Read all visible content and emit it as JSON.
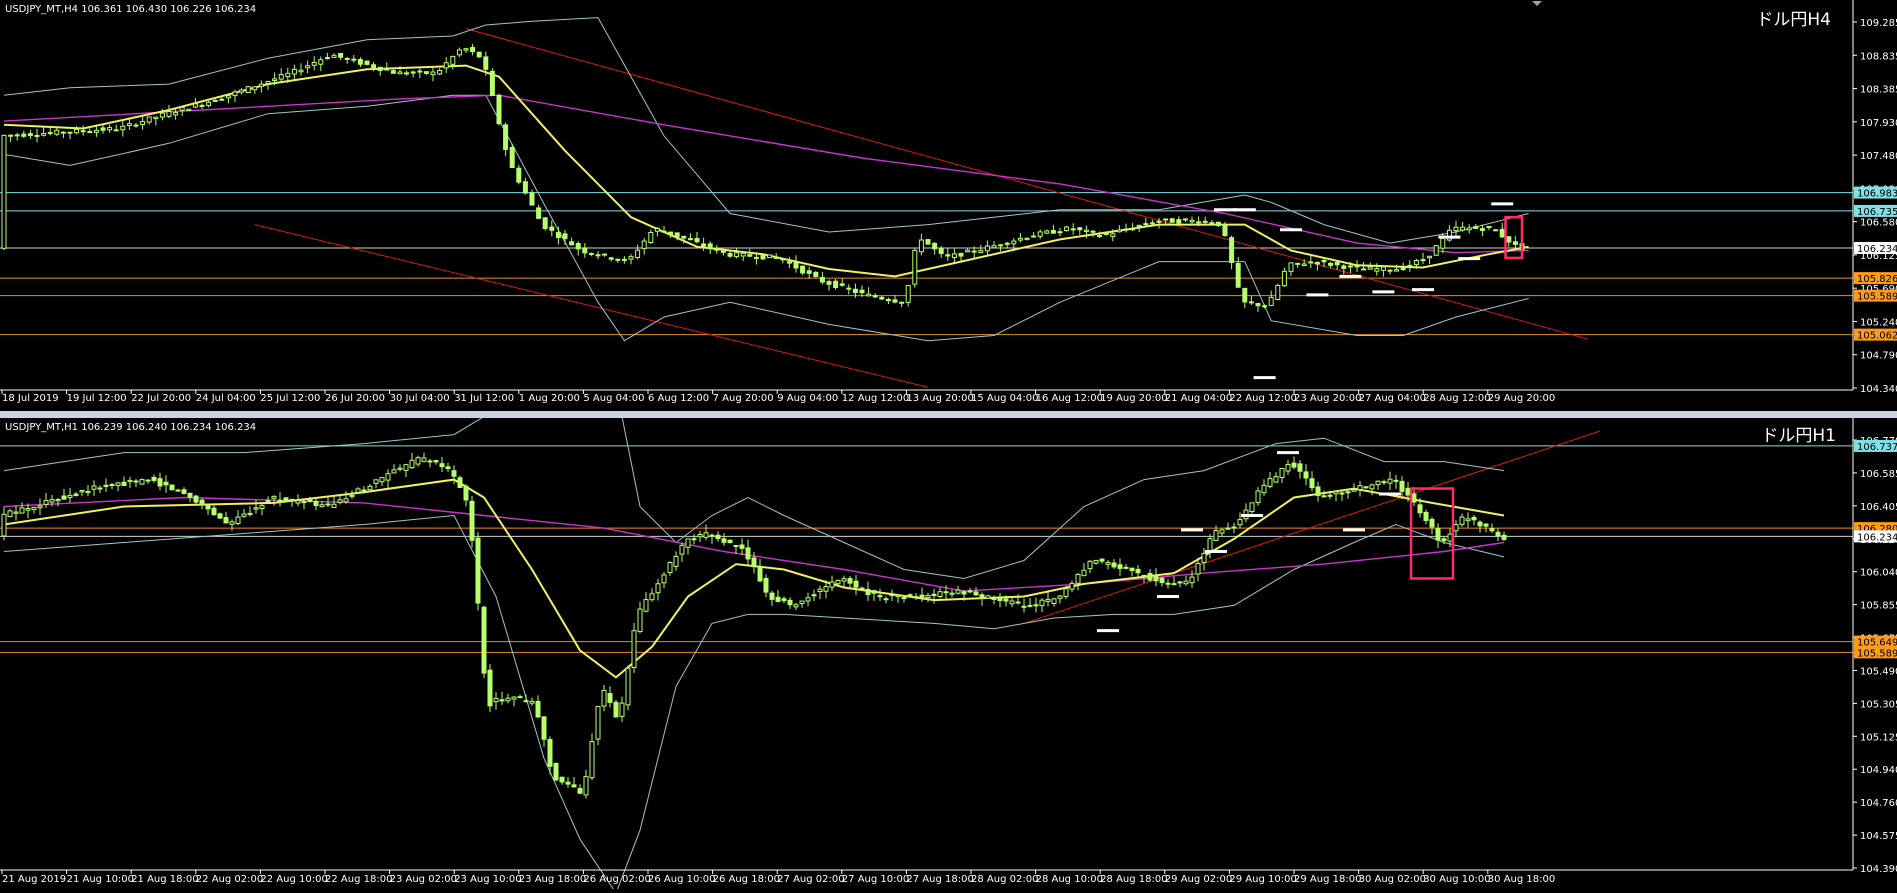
{
  "colors": {
    "background": "#000000",
    "axis": "#ffffff",
    "candle": "#b7ff6b",
    "ma_short": "#f0f060",
    "ma_long": "#cc33cc",
    "band": "#9ec7c7",
    "trend": "#e01818",
    "level_cyan": "#7fe0e6",
    "level_orange": "#f08a2a",
    "level_white": "#d0d0d0",
    "highlight": "#ff2a6d",
    "badge_orange": "#ff9a1a",
    "badge_cyan": "#7fe0e6",
    "badge_white": "#ffffff"
  },
  "chart_data": [
    {
      "type": "candlestick",
      "info": "USDJPY_MT,H4  106.361 106.430 106.226 106.234",
      "title": "ドル円H4",
      "ylim": [
        104.34,
        109.29
      ],
      "y_ticks": [
        "109.285",
        "108.835",
        "108.385",
        "107.930",
        "107.480",
        "107.030",
        "106.580",
        "106.125",
        "105.690",
        "105.240",
        "104.790",
        "104.340"
      ],
      "x_ticks": [
        "18 Jul 2019",
        "19 Jul 12:00",
        "22 Jul 20:00",
        "24 Jul 04:00",
        "25 Jul 12:00",
        "26 Jul 20:00",
        "30 Jul 04:00",
        "31 Jul 12:00",
        "1 Aug 20:00",
        "5 Aug 04:00",
        "6 Aug 12:00",
        "7 Aug 20:00",
        "9 Aug 04:00",
        "12 Aug 12:00",
        "13 Aug 20:00",
        "15 Aug 04:00",
        "16 Aug 12:00",
        "19 Aug 20:00",
        "21 Aug 04:00",
        "22 Aug 12:00",
        "23 Aug 20:00",
        "27 Aug 04:00",
        "28 Aug 12:00",
        "29 Aug 20:00"
      ],
      "anchors": [
        [
          0,
          107.75
        ],
        [
          18,
          107.85
        ],
        [
          25,
          108.05
        ],
        [
          33,
          108.25
        ],
        [
          44,
          108.6
        ],
        [
          50,
          108.85
        ],
        [
          60,
          108.6
        ],
        [
          66,
          108.6
        ],
        [
          70,
          108.95
        ],
        [
          73,
          108.8
        ],
        [
          77,
          107.4
        ],
        [
          82,
          106.55
        ],
        [
          88,
          106.2
        ],
        [
          95,
          106.05
        ],
        [
          99,
          106.5
        ],
        [
          104,
          106.35
        ],
        [
          110,
          106.15
        ],
        [
          118,
          106.1
        ],
        [
          124,
          105.8
        ],
        [
          131,
          105.6
        ],
        [
          137,
          105.5
        ],
        [
          139,
          106.4
        ],
        [
          143,
          106.1
        ],
        [
          150,
          106.25
        ],
        [
          156,
          106.4
        ],
        [
          162,
          106.5
        ],
        [
          167,
          106.4
        ],
        [
          175,
          106.6
        ],
        [
          182,
          106.6
        ],
        [
          185,
          106.55
        ],
        [
          188,
          105.5
        ],
        [
          192,
          105.45
        ],
        [
          195,
          106.0
        ],
        [
          199,
          106.05
        ],
        [
          206,
          105.95
        ],
        [
          212,
          105.95
        ],
        [
          216,
          106.1
        ],
        [
          220,
          106.5
        ],
        [
          226,
          106.5
        ],
        [
          230,
          106.23
        ]
      ],
      "ma_short": [
        [
          0,
          107.9
        ],
        [
          12,
          107.85
        ],
        [
          25,
          108.1
        ],
        [
          40,
          108.45
        ],
        [
          55,
          108.65
        ],
        [
          70,
          108.7
        ],
        [
          75,
          108.55
        ],
        [
          85,
          107.55
        ],
        [
          95,
          106.65
        ],
        [
          105,
          106.25
        ],
        [
          115,
          106.15
        ],
        [
          125,
          105.95
        ],
        [
          135,
          105.85
        ],
        [
          145,
          106.05
        ],
        [
          160,
          106.35
        ],
        [
          175,
          106.55
        ],
        [
          188,
          106.55
        ],
        [
          195,
          106.2
        ],
        [
          205,
          106.0
        ],
        [
          215,
          105.97
        ],
        [
          225,
          106.15
        ],
        [
          231,
          106.25
        ]
      ],
      "ma_long": [
        [
          0,
          107.95
        ],
        [
          30,
          108.1
        ],
        [
          60,
          108.25
        ],
        [
          75,
          108.3
        ],
        [
          100,
          107.9
        ],
        [
          130,
          107.45
        ],
        [
          160,
          107.1
        ],
        [
          185,
          106.7
        ],
        [
          205,
          106.3
        ],
        [
          220,
          106.17
        ],
        [
          231,
          106.2
        ]
      ],
      "band_upper": [
        [
          0,
          108.3
        ],
        [
          10,
          108.4
        ],
        [
          25,
          108.45
        ],
        [
          40,
          108.8
        ],
        [
          55,
          109.05
        ],
        [
          68,
          109.1
        ],
        [
          73,
          109.25
        ],
        [
          80,
          109.3
        ],
        [
          90,
          109.35
        ],
        [
          100,
          107.75
        ],
        [
          110,
          106.7
        ],
        [
          125,
          106.45
        ],
        [
          140,
          106.55
        ],
        [
          160,
          106.75
        ],
        [
          175,
          106.75
        ],
        [
          188,
          106.95
        ],
        [
          192,
          106.85
        ],
        [
          200,
          106.55
        ],
        [
          210,
          106.3
        ],
        [
          220,
          106.45
        ],
        [
          231,
          106.7
        ]
      ],
      "band_lower": [
        [
          0,
          107.5
        ],
        [
          10,
          107.35
        ],
        [
          25,
          107.65
        ],
        [
          40,
          108.05
        ],
        [
          55,
          108.15
        ],
        [
          68,
          108.3
        ],
        [
          73,
          108.3
        ],
        [
          82,
          106.8
        ],
        [
          90,
          105.5
        ],
        [
          94,
          104.98
        ],
        [
          100,
          105.3
        ],
        [
          110,
          105.5
        ],
        [
          125,
          105.2
        ],
        [
          140,
          104.98
        ],
        [
          150,
          105.05
        ],
        [
          160,
          105.5
        ],
        [
          175,
          106.05
        ],
        [
          188,
          106.05
        ],
        [
          192,
          105.25
        ],
        [
          205,
          105.05
        ],
        [
          212,
          105.05
        ],
        [
          220,
          105.3
        ],
        [
          231,
          105.55
        ]
      ],
      "trend_lines": [
        {
          "x1": 70,
          "y1": 109.2,
          "x2": 240,
          "y2": 105.0
        },
        {
          "x1": 38,
          "y1": 106.55,
          "x2": 140,
          "y2": 104.35
        }
      ],
      "h_lines": [
        {
          "value": 106.983,
          "label": "106.983",
          "kind": "cyan"
        },
        {
          "value": 106.735,
          "label": "106.735",
          "kind": "cyan"
        },
        {
          "value": 106.234,
          "label": "106.234",
          "kind": "white"
        },
        {
          "value": 105.826,
          "label": "105.826",
          "kind": "orange"
        },
        {
          "value": 105.589,
          "label": "105.589",
          "kind": "orange"
        },
        {
          "value": 105.062,
          "label": "105.062",
          "kind": "orange"
        }
      ],
      "markers": [
        [
          185,
          106.75
        ],
        [
          188,
          106.75
        ],
        [
          191,
          104.48
        ],
        [
          195,
          106.48
        ],
        [
          199,
          105.6
        ],
        [
          204,
          105.85
        ],
        [
          209,
          105.64
        ],
        [
          215,
          105.67
        ],
        [
          219,
          106.38
        ],
        [
          222,
          106.09
        ],
        [
          227,
          106.83
        ]
      ],
      "highlight": {
        "x1": 227.5,
        "x2": 230,
        "y1": 106.1,
        "y2": 106.65
      },
      "extra_badges": [
        {
          "value": 106.125,
          "label": "106.125"
        },
        {
          "value": 105.69,
          "label": "105.690"
        }
      ]
    },
    {
      "type": "candlestick",
      "info": "USDJPY_MT,H1  106.239 106.240 106.234 106.234",
      "title": "ドル円H1",
      "ylim": [
        104.39,
        106.77
      ],
      "y_ticks": [
        "106.770",
        "106.585",
        "106.405",
        "106.220",
        "106.040",
        "105.855",
        "105.675",
        "105.490",
        "105.305",
        "105.125",
        "104.940",
        "104.760",
        "104.575",
        "104.390"
      ],
      "x_ticks": [
        "21 Aug 2019",
        "21 Aug 10:00",
        "21 Aug 18:00",
        "22 Aug 02:00",
        "22 Aug 10:00",
        "22 Aug 18:00",
        "23 Aug 02:00",
        "23 Aug 10:00",
        "23 Aug 18:00",
        "26 Aug 02:00",
        "26 Aug 10:00",
        "26 Aug 18:00",
        "27 Aug 02:00",
        "27 Aug 10:00",
        "27 Aug 18:00",
        "28 Aug 02:00",
        "28 Aug 10:00",
        "28 Aug 18:00",
        "29 Aug 02:00",
        "29 Aug 10:00",
        "29 Aug 18:00",
        "30 Aug 02:00",
        "30 Aug 10:00",
        "30 Aug 18:00"
      ],
      "anchors": [
        [
          0,
          106.35
        ],
        [
          15,
          106.5
        ],
        [
          25,
          106.55
        ],
        [
          32,
          106.45
        ],
        [
          38,
          106.3
        ],
        [
          45,
          106.45
        ],
        [
          55,
          106.4
        ],
        [
          63,
          106.55
        ],
        [
          70,
          106.67
        ],
        [
          75,
          106.6
        ],
        [
          78,
          106.4
        ],
        [
          81,
          105.3
        ],
        [
          85,
          105.35
        ],
        [
          89,
          105.3
        ],
        [
          92,
          104.9
        ],
        [
          97,
          104.8
        ],
        [
          100,
          105.4
        ],
        [
          103,
          105.2
        ],
        [
          106,
          105.8
        ],
        [
          110,
          106.0
        ],
        [
          114,
          106.2
        ],
        [
          118,
          106.25
        ],
        [
          124,
          106.15
        ],
        [
          128,
          105.9
        ],
        [
          132,
          105.85
        ],
        [
          140,
          106.0
        ],
        [
          146,
          105.9
        ],
        [
          154,
          105.9
        ],
        [
          160,
          105.93
        ],
        [
          170,
          105.85
        ],
        [
          176,
          105.88
        ],
        [
          182,
          106.1
        ],
        [
          188,
          106.05
        ],
        [
          194,
          105.97
        ],
        [
          198,
          105.98
        ],
        [
          202,
          106.25
        ],
        [
          206,
          106.3
        ],
        [
          210,
          106.5
        ],
        [
          215,
          106.65
        ],
        [
          220,
          106.45
        ],
        [
          226,
          106.5
        ],
        [
          232,
          106.55
        ],
        [
          236,
          106.4
        ],
        [
          240,
          106.2
        ],
        [
          244,
          106.35
        ],
        [
          248,
          106.28
        ],
        [
          250,
          106.23
        ]
      ],
      "ma_short": [
        [
          0,
          106.3
        ],
        [
          20,
          106.4
        ],
        [
          45,
          106.42
        ],
        [
          60,
          106.48
        ],
        [
          75,
          106.55
        ],
        [
          80,
          106.45
        ],
        [
          88,
          106.05
        ],
        [
          96,
          105.6
        ],
        [
          102,
          105.45
        ],
        [
          108,
          105.62
        ],
        [
          114,
          105.9
        ],
        [
          122,
          106.08
        ],
        [
          130,
          106.05
        ],
        [
          140,
          105.95
        ],
        [
          155,
          105.88
        ],
        [
          170,
          105.9
        ],
        [
          180,
          105.97
        ],
        [
          195,
          106.03
        ],
        [
          205,
          106.22
        ],
        [
          215,
          106.45
        ],
        [
          225,
          106.5
        ],
        [
          238,
          106.42
        ],
        [
          250,
          106.35
        ]
      ],
      "ma_long": [
        [
          0,
          106.4
        ],
        [
          30,
          106.45
        ],
        [
          60,
          106.42
        ],
        [
          80,
          106.35
        ],
        [
          100,
          106.28
        ],
        [
          120,
          106.15
        ],
        [
          140,
          106.05
        ],
        [
          160,
          105.93
        ],
        [
          180,
          105.97
        ],
        [
          200,
          106.03
        ],
        [
          220,
          106.08
        ],
        [
          240,
          106.15
        ],
        [
          250,
          106.2
        ]
      ],
      "band_upper": [
        [
          0,
          106.6
        ],
        [
          20,
          106.7
        ],
        [
          40,
          106.7
        ],
        [
          60,
          106.75
        ],
        [
          75,
          106.8
        ],
        [
          85,
          107.0
        ],
        [
          100,
          107.4
        ],
        [
          106,
          106.4
        ],
        [
          112,
          106.2
        ],
        [
          118,
          106.35
        ],
        [
          124,
          106.45
        ],
        [
          130,
          106.35
        ],
        [
          140,
          106.2
        ],
        [
          150,
          106.05
        ],
        [
          160,
          106.0
        ],
        [
          170,
          106.1
        ],
        [
          180,
          106.4
        ],
        [
          190,
          106.55
        ],
        [
          200,
          106.6
        ],
        [
          212,
          106.75
        ],
        [
          220,
          106.78
        ],
        [
          230,
          106.65
        ],
        [
          240,
          106.65
        ],
        [
          250,
          106.6
        ]
      ],
      "band_lower": [
        [
          0,
          106.15
        ],
        [
          20,
          106.2
        ],
        [
          40,
          106.25
        ],
        [
          60,
          106.3
        ],
        [
          75,
          106.35
        ],
        [
          82,
          105.9
        ],
        [
          90,
          105.0
        ],
        [
          96,
          104.55
        ],
        [
          102,
          104.25
        ],
        [
          106,
          104.6
        ],
        [
          112,
          105.4
        ],
        [
          118,
          105.75
        ],
        [
          124,
          105.8
        ],
        [
          130,
          105.8
        ],
        [
          140,
          105.78
        ],
        [
          155,
          105.75
        ],
        [
          165,
          105.72
        ],
        [
          175,
          105.78
        ],
        [
          185,
          105.8
        ],
        [
          195,
          105.8
        ],
        [
          205,
          105.85
        ],
        [
          215,
          106.05
        ],
        [
          225,
          106.2
        ],
        [
          232,
          106.3
        ],
        [
          240,
          106.2
        ],
        [
          250,
          106.12
        ]
      ],
      "trend_lines": [
        {
          "x1": 170,
          "y1": 105.75,
          "x2": 266,
          "y2": 106.82
        }
      ],
      "h_lines": [
        {
          "value": 106.737,
          "label": "106.737",
          "kind": "cyan"
        },
        {
          "value": 106.28,
          "label": "106.280",
          "kind": "orange"
        },
        {
          "value": 106.234,
          "label": "106.234",
          "kind": "white"
        },
        {
          "value": 105.649,
          "label": "105.649",
          "kind": "orange"
        },
        {
          "value": 105.589,
          "label": "105.589",
          "kind": "orange"
        }
      ],
      "markers": [
        [
          184,
          105.71
        ],
        [
          194,
          105.9
        ],
        [
          198,
          106.27
        ],
        [
          202,
          106.15
        ],
        [
          208,
          106.35
        ],
        [
          214,
          106.7
        ],
        [
          225,
          106.27
        ],
        [
          231,
          106.47
        ]
      ],
      "highlight": {
        "x1": 234.5,
        "x2": 241.5,
        "y1": 106.0,
        "y2": 106.5
      }
    }
  ]
}
